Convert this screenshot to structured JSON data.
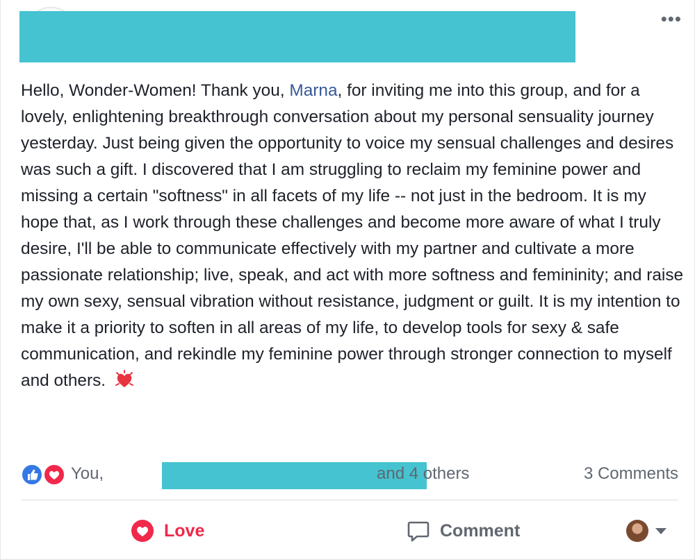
{
  "post": {
    "text_before_mention": "Hello, Wonder-Women! Thank you, ",
    "mention": "Marna",
    "text_after_mention": ", for inviting me into this group, and for a lovely, enlightening breakthrough conversation about my personal sensuality journey yesterday. Just being given the opportunity to voice my sensual challenges and desires was such a gift. I discovered that I am struggling to reclaim my feminine power and missing a certain \"softness\" in all facets of my life -- not just in the bedroom. It is my hope that, as I work through these challenges and become more aware of what I truly desire, I'll be able to communicate effectively with my partner and cultivate a more passionate relationship; live, speak, and act with more softness and femininity; and raise my own sexy, sensual vibration without resistance, judgment or guilt. It is my intention to make it a priority to soften in all areas of my life, to develop tools for sexy & safe communication, and rekindle my feminine power through stronger connection to myself and others. ",
    "emoji_icon": "beating-heart-icon",
    "more_icon": "•••"
  },
  "reactions": {
    "icons": [
      "like-icon",
      "love-icon"
    ],
    "you_label": "You,",
    "others_label": "and 4 others",
    "comments_label": "3 Comments"
  },
  "actions": {
    "love_label": "Love",
    "comment_label": "Comment"
  },
  "colors": {
    "redaction": "#45c3d0",
    "love": "#f0284a",
    "like": "#3578e5",
    "mention": "#365899",
    "muted": "#606770"
  }
}
